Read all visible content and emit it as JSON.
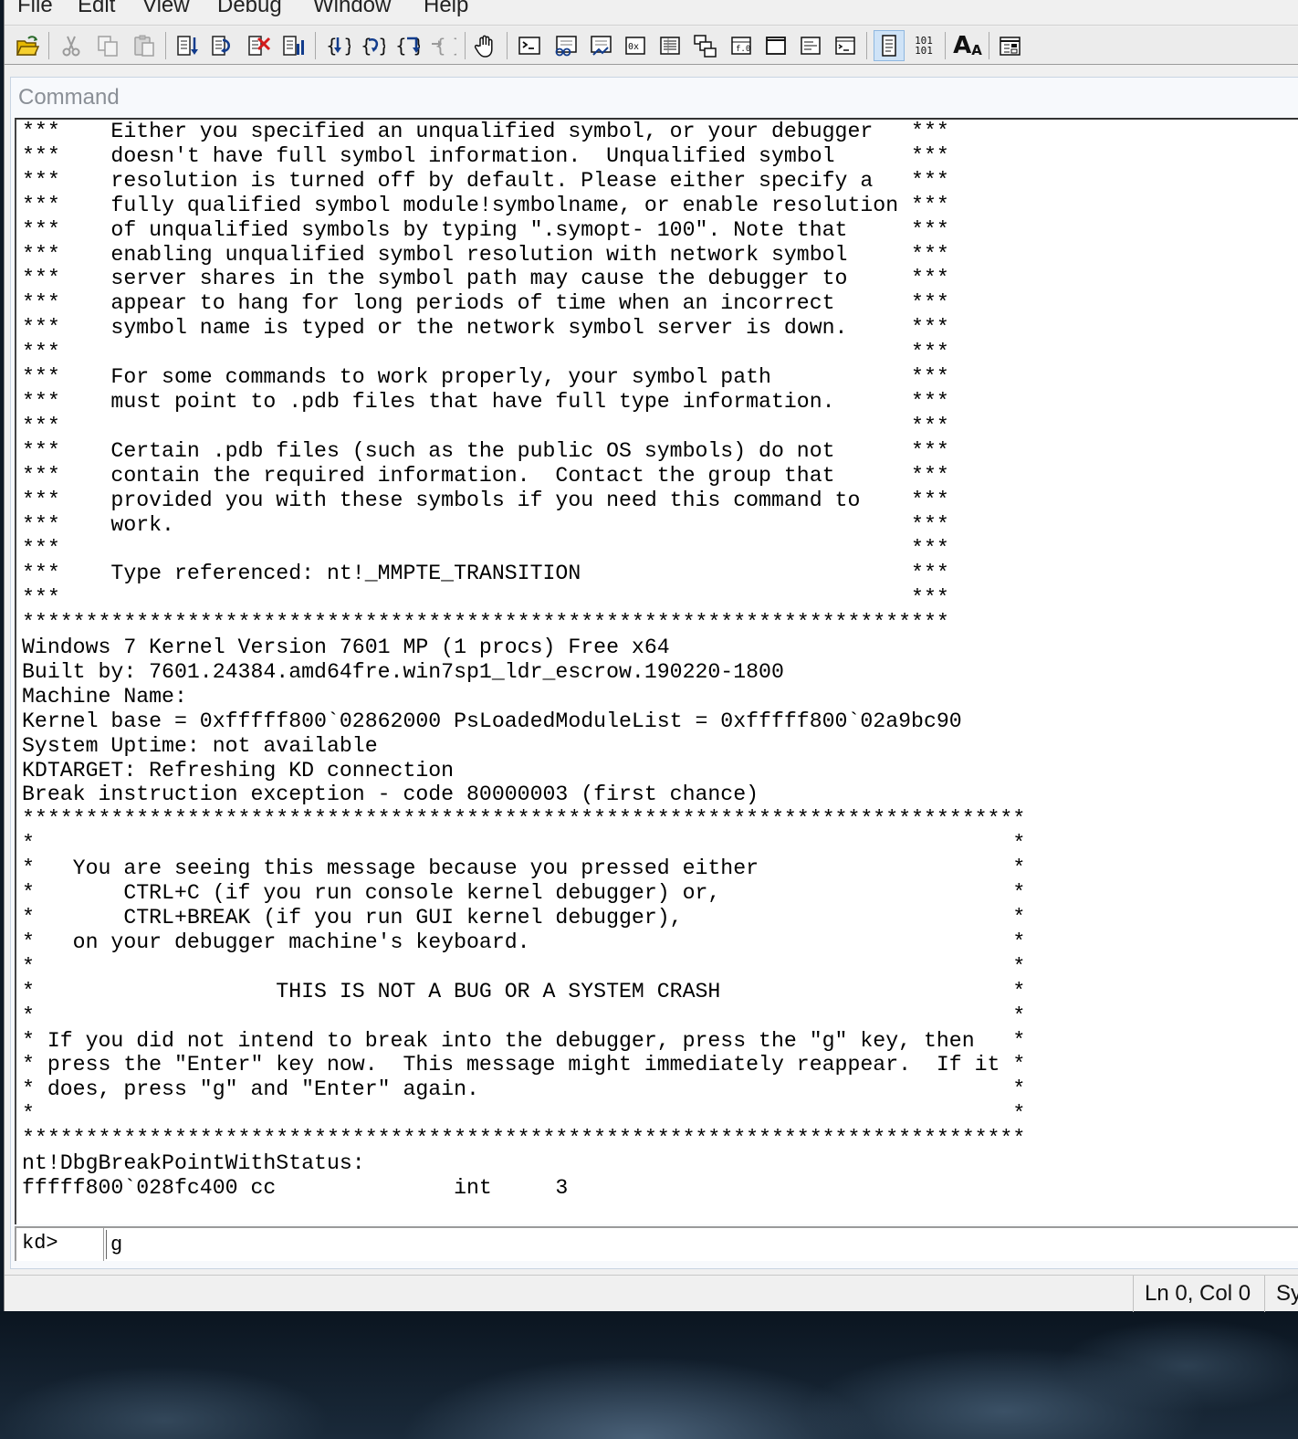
{
  "menu": {
    "items": [
      "File",
      "Edit",
      "View",
      "Debug",
      "Window",
      "Help"
    ]
  },
  "toolbar": {
    "icons": [
      "open-icon",
      "cut-icon",
      "copy-icon",
      "paste-icon",
      "step-into-icon",
      "step-over-icon",
      "stop-icon",
      "break-icon",
      "source-step-into-icon",
      "source-step-over-icon",
      "step-out-icon",
      "run-to-cursor-icon",
      "hand-icon",
      "command-window-icon",
      "watch-icon",
      "locals-icon",
      "registers-icon",
      "memory-icon",
      "call-stack-icon",
      "disassembly-icon",
      "scratch-pad-icon",
      "processes-icon",
      "source-mode-icon",
      "hex-mode-icon",
      "font-icon",
      "options-icon"
    ],
    "hex_glyph": "101\n101",
    "font_glyph_big": "A",
    "font_glyph_small": "A"
  },
  "command_panel": {
    "title": "Command",
    "output_lines": [
      "***    Either you specified an unqualified symbol, or your debugger   ***",
      "***    doesn't have full symbol information.  Unqualified symbol      ***",
      "***    resolution is turned off by default. Please either specify a   ***",
      "***    fully qualified symbol module!symbolname, or enable resolution ***",
      "***    of unqualified symbols by typing \".symopt- 100\". Note that     ***",
      "***    enabling unqualified symbol resolution with network symbol     ***",
      "***    server shares in the symbol path may cause the debugger to     ***",
      "***    appear to hang for long periods of time when an incorrect      ***",
      "***    symbol name is typed or the network symbol server is down.     ***",
      "***                                                                   ***",
      "***    For some commands to work properly, your symbol path           ***",
      "***    must point to .pdb files that have full type information.      ***",
      "***                                                                   ***",
      "***    Certain .pdb files (such as the public OS symbols) do not      ***",
      "***    contain the required information.  Contact the group that      ***",
      "***    provided you with these symbols if you need this command to    ***",
      "***    work.                                                          ***",
      "***                                                                   ***",
      "***    Type referenced: nt!_MMPTE_TRANSITION                          ***",
      "***                                                                   ***",
      "*************************************************************************",
      "Windows 7 Kernel Version 7601 MP (1 procs) Free x64",
      "Built by: 7601.24384.amd64fre.win7sp1_ldr_escrow.190220-1800",
      "Machine Name:",
      "Kernel base = 0xfffff800`02862000 PsLoadedModuleList = 0xfffff800`02a9bc90",
      "System Uptime: not available",
      "KDTARGET: Refreshing KD connection",
      "Break instruction exception - code 80000003 (first chance)",
      "*******************************************************************************",
      "*                                                                             *",
      "*   You are seeing this message because you pressed either                    *",
      "*       CTRL+C (if you run console kernel debugger) or,                       *",
      "*       CTRL+BREAK (if you run GUI kernel debugger),                          *",
      "*   on your debugger machine's keyboard.                                      *",
      "*                                                                             *",
      "*                   THIS IS NOT A BUG OR A SYSTEM CRASH                       *",
      "*                                                                             *",
      "* If you did not intend to break into the debugger, press the \"g\" key, then   *",
      "* press the \"Enter\" key now.  This message might immediately reappear.  If it *",
      "* does, press \"g\" and \"Enter\" again.                                          *",
      "*                                                                             *",
      "*******************************************************************************",
      "nt!DbgBreakPointWithStatus:",
      "fffff800`028fc400 cc              int     3"
    ],
    "prompt": "kd>",
    "input_value": "g"
  },
  "statusbar": {
    "position": "Ln 0, Col 0",
    "next_cell": "Sy"
  }
}
